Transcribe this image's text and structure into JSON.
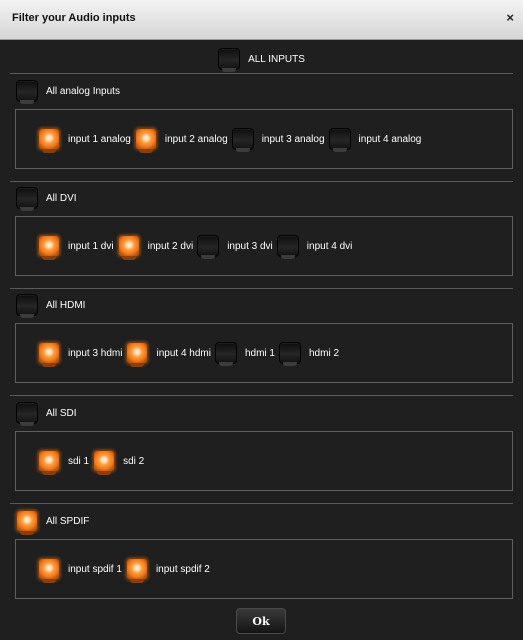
{
  "window": {
    "title": "Filter your Audio inputs",
    "close_glyph": "×"
  },
  "all_inputs": {
    "label": "ALL INPUTS",
    "checked": false
  },
  "groups": [
    {
      "label": "All analog Inputs",
      "checked": false,
      "items": [
        {
          "label": "input 1 analog",
          "checked": true
        },
        {
          "label": "input 2 analog",
          "checked": true
        },
        {
          "label": "input 3 analog",
          "checked": false
        },
        {
          "label": "input 4 analog",
          "checked": false
        }
      ]
    },
    {
      "label": "All DVI",
      "checked": false,
      "items": [
        {
          "label": "input 1 dvi",
          "checked": true
        },
        {
          "label": "input 2 dvi",
          "checked": true
        },
        {
          "label": "input 3 dvi",
          "checked": false
        },
        {
          "label": "input 4 dvi",
          "checked": false
        }
      ]
    },
    {
      "label": "All HDMI",
      "checked": false,
      "items": [
        {
          "label": "input 3 hdmi",
          "checked": true
        },
        {
          "label": "input 4 hdmi",
          "checked": true
        },
        {
          "label": "hdmi 1",
          "checked": false
        },
        {
          "label": "hdmi 2",
          "checked": false
        }
      ]
    },
    {
      "label": "All SDI",
      "checked": false,
      "items": [
        {
          "label": "sdi 1",
          "checked": true
        },
        {
          "label": "sdi 2",
          "checked": true
        }
      ]
    },
    {
      "label": "All SPDIF",
      "checked": true,
      "items": [
        {
          "label": "input spdif 1",
          "checked": true
        },
        {
          "label": "input spdif 2",
          "checked": true
        }
      ]
    }
  ],
  "ok_label": "Ok",
  "colors": {
    "titlebar": "#e6e6e6",
    "background": "#1f1f1f",
    "toggle_on": "#f0781e",
    "toggle_off": "#1a1a1a",
    "border": "#5f5f5f"
  },
  "icons": {
    "toggle_on": "orange-toggle-icon",
    "toggle_off": "dark-toggle-icon"
  }
}
